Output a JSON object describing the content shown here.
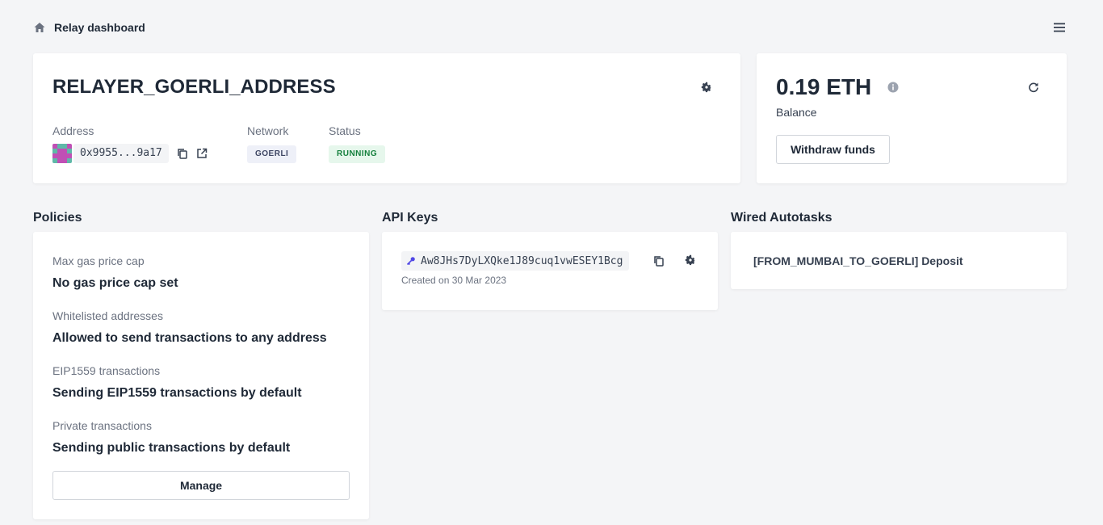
{
  "header": {
    "title": "Relay dashboard",
    "home_icon": "home-icon",
    "menu_icon": "hamburger-menu-icon"
  },
  "relayer": {
    "name": "RELAYER_GOERLI_ADDRESS",
    "address_label": "Address",
    "address": "0x9955...9a17",
    "network_label": "Network",
    "network": "GOERLI",
    "status_label": "Status",
    "status": "RUNNING",
    "status_color": "#15803d"
  },
  "balance": {
    "amount": "0.19 ETH",
    "label": "Balance",
    "withdraw_label": "Withdraw funds"
  },
  "policies": {
    "title": "Policies",
    "items": [
      {
        "label": "Max gas price cap",
        "value": "No gas price cap set"
      },
      {
        "label": "Whitelisted addresses",
        "value": "Allowed to send transactions to any address"
      },
      {
        "label": "EIP1559 transactions",
        "value": "Sending EIP1559 transactions by default"
      },
      {
        "label": "Private transactions",
        "value": "Sending public transactions by default"
      }
    ],
    "manage_label": "Manage"
  },
  "api_keys": {
    "title": "API Keys",
    "key": "Aw8JHs7DyLXQke1J89cuq1vwESEY1Bcg",
    "created": "Created on 30 Mar 2023",
    "key_icon_color": "#4f46e5"
  },
  "autotasks": {
    "title": "Wired Autotasks",
    "items": [
      "[FROM_MUMBAI_TO_GOERLI] Deposit"
    ]
  }
}
